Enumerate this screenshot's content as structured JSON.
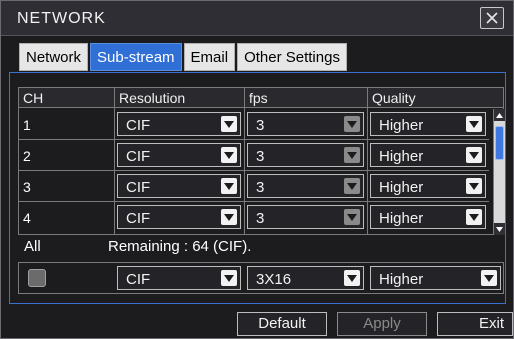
{
  "window": {
    "title": "NETWORK"
  },
  "tabs": [
    {
      "label": "Network",
      "active": false
    },
    {
      "label": "Sub-stream",
      "active": true
    },
    {
      "label": "Email",
      "active": false
    },
    {
      "label": "Other Settings",
      "active": false
    }
  ],
  "table": {
    "headers": {
      "ch": "CH",
      "resolution": "Resolution",
      "fps": "fps",
      "quality": "Quality"
    },
    "rows": [
      {
        "ch": "1",
        "resolution": "CIF",
        "fps": "3",
        "quality": "Higher"
      },
      {
        "ch": "2",
        "resolution": "CIF",
        "fps": "3",
        "quality": "Higher"
      },
      {
        "ch": "3",
        "resolution": "CIF",
        "fps": "3",
        "quality": "Higher"
      },
      {
        "ch": "4",
        "resolution": "CIF",
        "fps": "3",
        "quality": "Higher"
      }
    ]
  },
  "all": {
    "label": "All",
    "remaining": "Remaining : 64 (CIF).",
    "resolution": "CIF",
    "fps": "3X16",
    "quality": "Higher"
  },
  "buttons": {
    "default": "Default",
    "apply": "Apply",
    "exit": "Exit"
  },
  "colors": {
    "accent": "#2f6fd6",
    "background": "#1c1c1f"
  }
}
